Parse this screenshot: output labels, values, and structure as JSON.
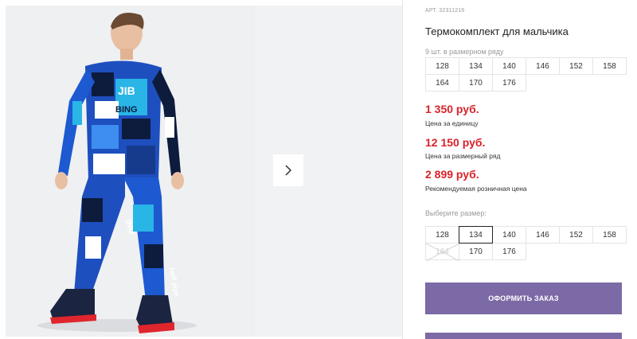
{
  "product": {
    "article_label": "АРТ.",
    "article_number": "32311216",
    "title": "Термокомплект для мальчика",
    "pack_label": "9 шт. в размерном ряду",
    "pack_sizes": [
      "128",
      "134",
      "140",
      "146",
      "152",
      "158",
      "164",
      "170",
      "176"
    ]
  },
  "prices": {
    "unit_price": "1 350 руб.",
    "unit_note": "Цена за единицу",
    "pack_price": "12 150 руб.",
    "pack_note": "Цена за размерный ряд",
    "retail_price": "2 899 руб.",
    "retail_note": "Рекомендуемая розничная цена"
  },
  "size_picker": {
    "label": "Выберите размер:",
    "sizes": [
      "128",
      "134",
      "140",
      "146",
      "152",
      "158",
      "164",
      "170",
      "176"
    ],
    "selected": "134",
    "disabled": [
      "164"
    ]
  },
  "actions": {
    "order_label": "ОФОРМИТЬ ЗАКАЗ"
  },
  "photo_text": {
    "print_words": [
      "JIB",
      "BING",
      "half pipe",
      "ING"
    ]
  },
  "colors": {
    "price_red": "#d9222a",
    "button_purple": "#7c6aa6"
  },
  "icons": {
    "next": "chevron-right-icon"
  }
}
